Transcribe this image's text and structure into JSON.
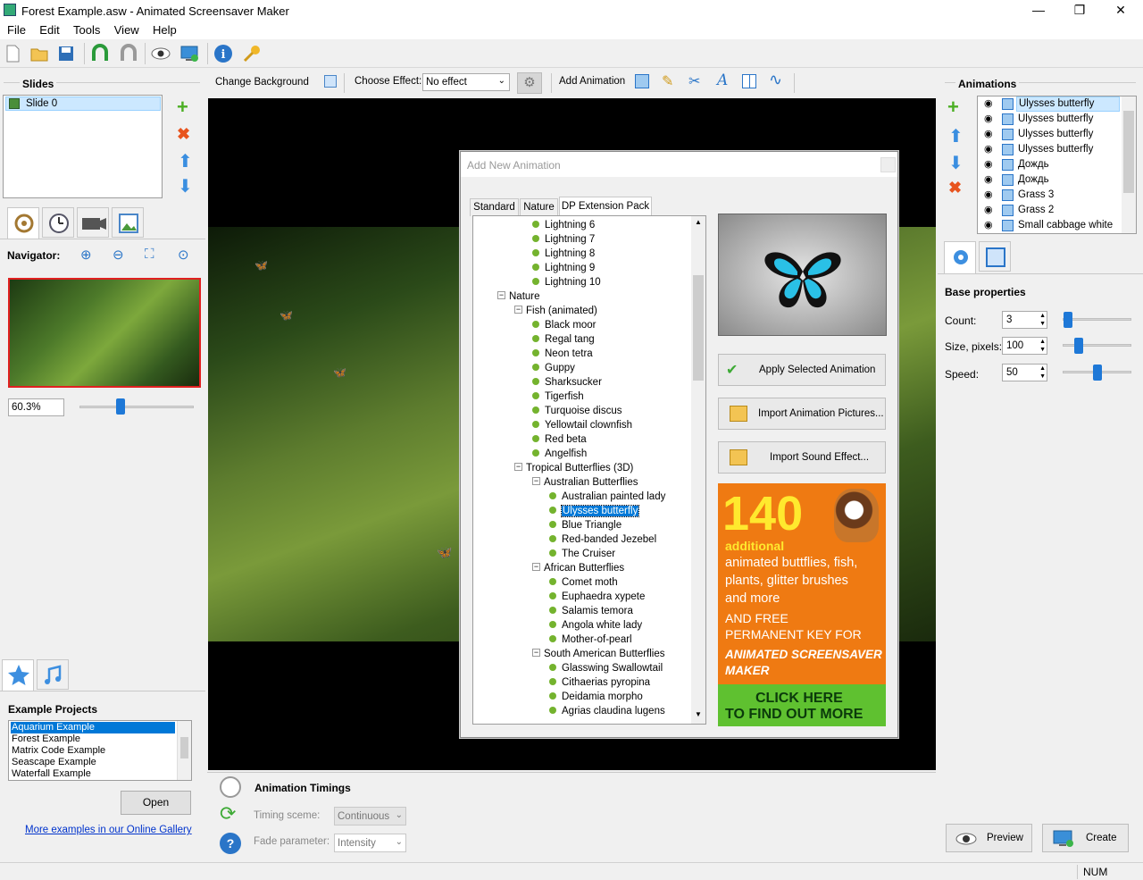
{
  "window": {
    "title": "Forest Example.asw - Animated Screensaver Maker",
    "minimize": "—",
    "maximize": "❐",
    "close": "✕"
  },
  "menu": [
    "File",
    "Edit",
    "Tools",
    "View",
    "Help"
  ],
  "slides": {
    "title": "Slides",
    "items": [
      "Slide 0"
    ]
  },
  "navigator": {
    "label": "Navigator:",
    "zoom": "60.3%",
    "zoom_level": 0.35
  },
  "examples": {
    "title": "Example Projects",
    "items": [
      "Aquarium Example",
      "Forest Example",
      "Matrix Code Example",
      "Seascape Example",
      "Waterfall Example"
    ],
    "selected": "Aquarium Example",
    "open_label": "Open",
    "gallery_link": "More examples in our Online Gallery"
  },
  "slide_toolbar": {
    "change_bg": "Change Background",
    "choose_effect": "Choose Effect:",
    "effect_value": "No effect",
    "add_animation": "Add Animation"
  },
  "dialog": {
    "title": "Add New Animation",
    "tabs": [
      "Standard",
      "Nature",
      "DP Extension Pack"
    ],
    "active_tab": "DP Extension Pack",
    "tree": [
      {
        "t": "Lightning 6",
        "lvl": 3,
        "leaf": true
      },
      {
        "t": "Lightning 7",
        "lvl": 3,
        "leaf": true
      },
      {
        "t": "Lightning 8",
        "lvl": 3,
        "leaf": true
      },
      {
        "t": "Lightning 9",
        "lvl": 3,
        "leaf": true
      },
      {
        "t": "Lightning 10",
        "lvl": 3,
        "leaf": true
      },
      {
        "t": "Nature",
        "lvl": 1,
        "leaf": false
      },
      {
        "t": "Fish (animated)",
        "lvl": 2,
        "leaf": false
      },
      {
        "t": "Black moor",
        "lvl": 3,
        "leaf": true
      },
      {
        "t": "Regal tang",
        "lvl": 3,
        "leaf": true
      },
      {
        "t": "Neon tetra",
        "lvl": 3,
        "leaf": true
      },
      {
        "t": "Guppy",
        "lvl": 3,
        "leaf": true
      },
      {
        "t": "Sharksucker",
        "lvl": 3,
        "leaf": true
      },
      {
        "t": "Tigerfish",
        "lvl": 3,
        "leaf": true
      },
      {
        "t": "Turquoise discus",
        "lvl": 3,
        "leaf": true
      },
      {
        "t": "Yellowtail clownfish",
        "lvl": 3,
        "leaf": true
      },
      {
        "t": "Red beta",
        "lvl": 3,
        "leaf": true
      },
      {
        "t": "Angelfish",
        "lvl": 3,
        "leaf": true
      },
      {
        "t": "Tropical Butterflies (3D)",
        "lvl": 2,
        "leaf": false
      },
      {
        "t": "Australian Butterflies",
        "lvl": 3,
        "leaf": false
      },
      {
        "t": "Australian painted lady",
        "lvl": 4,
        "leaf": true
      },
      {
        "t": "Ulysses butterfly",
        "lvl": 4,
        "leaf": true,
        "selected": true
      },
      {
        "t": "Blue Triangle",
        "lvl": 4,
        "leaf": true
      },
      {
        "t": "Red-banded Jezebel",
        "lvl": 4,
        "leaf": true
      },
      {
        "t": "The Cruiser",
        "lvl": 4,
        "leaf": true
      },
      {
        "t": "African Butterflies",
        "lvl": 3,
        "leaf": false
      },
      {
        "t": "Comet moth",
        "lvl": 4,
        "leaf": true
      },
      {
        "t": "Euphaedra xypete",
        "lvl": 4,
        "leaf": true
      },
      {
        "t": "Salamis temora",
        "lvl": 4,
        "leaf": true
      },
      {
        "t": "Angola white lady",
        "lvl": 4,
        "leaf": true
      },
      {
        "t": "Mother-of-pearl",
        "lvl": 4,
        "leaf": true
      },
      {
        "t": "South American Butterflies",
        "lvl": 3,
        "leaf": false
      },
      {
        "t": "Glasswing Swallowtail",
        "lvl": 4,
        "leaf": true
      },
      {
        "t": "Cithaerias pyropina",
        "lvl": 4,
        "leaf": true
      },
      {
        "t": "Deidamia morpho",
        "lvl": 4,
        "leaf": true
      },
      {
        "t": "Agrias claudina lugens",
        "lvl": 4,
        "leaf": true
      }
    ],
    "apply": "Apply Selected Animation",
    "import_pictures": "Import Animation Pictures...",
    "import_sound": "Import Sound Effect...",
    "promo": {
      "number": "140",
      "additional": "additional",
      "line1": "animated buttflies, fish,",
      "line2": "plants, glitter brushes",
      "line3": "and more",
      "line4": "AND FREE",
      "line5": "PERMANENT KEY FOR",
      "line6": "ANIMATED SCREENSAVER",
      "line7": "MAKER",
      "cta1": "CLICK HERE",
      "cta2": "TO FIND OUT MORE"
    }
  },
  "animations": {
    "title": "Animations",
    "items": [
      "Ulysses butterfly",
      "Ulysses butterfly",
      "Ulysses butterfly",
      "Ulysses butterfly",
      "Дождь",
      "Дождь",
      "Grass 3",
      "Grass 2",
      "Small cabbage white"
    ]
  },
  "base": {
    "title": "Base properties",
    "count_label": "Count:",
    "count": "3",
    "size_label": "Size, pixels:",
    "size": "100",
    "speed_label": "Speed:",
    "speed": "50"
  },
  "timings": {
    "title": "Animation Timings",
    "scheme_label": "Timing sceme:",
    "scheme": "Continuous",
    "fade_label": "Fade parameter:",
    "fade": "Intensity"
  },
  "preview": "Preview",
  "create": "Create",
  "status": "NUM"
}
